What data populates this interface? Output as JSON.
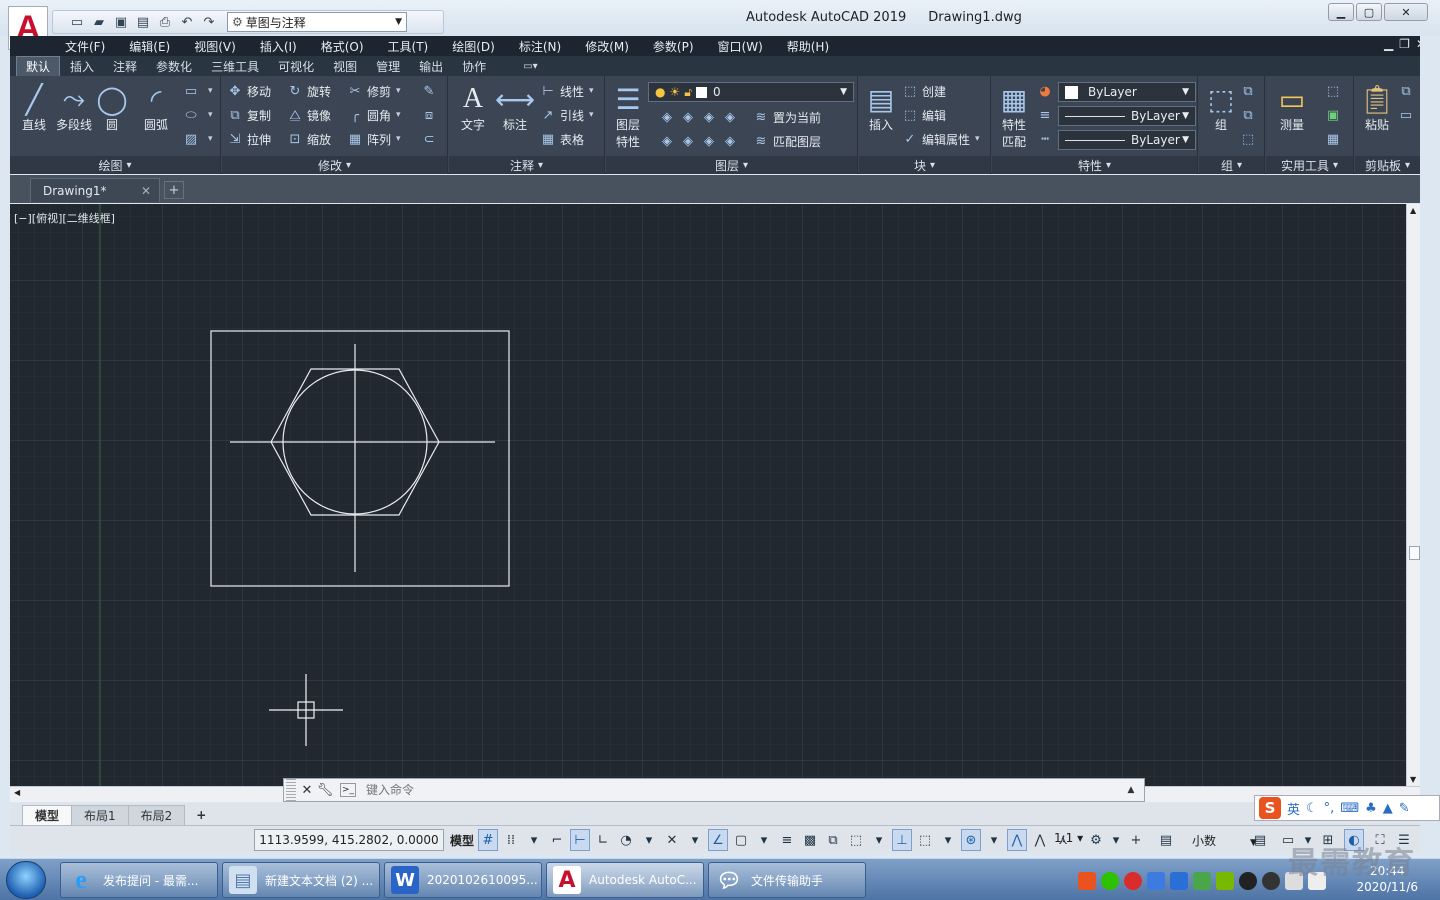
{
  "title_bar": {
    "app_title": "Autodesk AutoCAD 2019",
    "file_name": "Drawing1.dwg",
    "app_logo": "A",
    "workspace": "草图与注释"
  },
  "menu": [
    "文件(F)",
    "编辑(E)",
    "视图(V)",
    "插入(I)",
    "格式(O)",
    "工具(T)",
    "绘图(D)",
    "标注(N)",
    "修改(M)",
    "参数(P)",
    "窗口(W)",
    "帮助(H)"
  ],
  "ribbon_tabs": [
    "默认",
    "插入",
    "注释",
    "参数化",
    "三维工具",
    "可视化",
    "视图",
    "管理",
    "输出",
    "协作"
  ],
  "active_tab": "默认",
  "ribbon": {
    "draw": {
      "title": "绘图",
      "line": "直线",
      "polyline": "多段线",
      "circle": "圆",
      "arc": "圆弧"
    },
    "modify": {
      "title": "修改",
      "move": "移动",
      "rotate": "旋转",
      "trim": "修剪",
      "copy": "复制",
      "mirror": "镜像",
      "fillet": "圆角",
      "stretch": "拉伸",
      "scale": "缩放",
      "array": "阵列"
    },
    "annotation": {
      "title": "注释",
      "text": "文字",
      "dimension": "标注",
      "linear": "线性",
      "leader": "引线",
      "table": "表格"
    },
    "layers": {
      "title": "图层",
      "layer_props_1": "图层",
      "layer_props_2": "特性",
      "current_layer": "0",
      "make_current": "置为当前",
      "match_layer": "匹配图层"
    },
    "block": {
      "title": "块",
      "insert": "插入",
      "create": "创建",
      "edit": "编辑",
      "edit_attr": "编辑属性"
    },
    "properties": {
      "title": "特性",
      "match_1": "特性",
      "match_2": "匹配",
      "color": "ByLayer",
      "linetype": "ByLayer",
      "lineweight": "ByLayer"
    },
    "groups": {
      "title": "组",
      "group": "组"
    },
    "utilities": {
      "title": "实用工具",
      "measure": "测量"
    },
    "clipboard": {
      "title": "剪贴板",
      "paste": "粘贴"
    }
  },
  "doc_tab": {
    "name": "Drawing1*"
  },
  "viewport_label": "[−][俯视][二维线框]",
  "command": {
    "placeholder": "键入命令"
  },
  "layout_tabs": [
    "模型",
    "布局1",
    "布局2"
  ],
  "status": {
    "coords": "1113.9599, 415.2802, 0.0000",
    "model": "模型",
    "scale": "1:1",
    "units": "小数"
  },
  "ime": {
    "label": "英"
  },
  "taskbar": [
    {
      "label": "发布提问 - 最需...",
      "icon": "ie-icon"
    },
    {
      "label": "新建文本文档 (2) ...",
      "icon": "notepad-icon"
    },
    {
      "label": "2020102610095...",
      "icon": "word-icon"
    },
    {
      "label": "Autodesk AutoC...",
      "icon": "autocad-icon"
    },
    {
      "label": "文件传输助手",
      "icon": "wechat-icon"
    }
  ],
  "clock": {
    "time": "20:44",
    "date": "2020/11/6"
  },
  "watermark": "最需教育"
}
